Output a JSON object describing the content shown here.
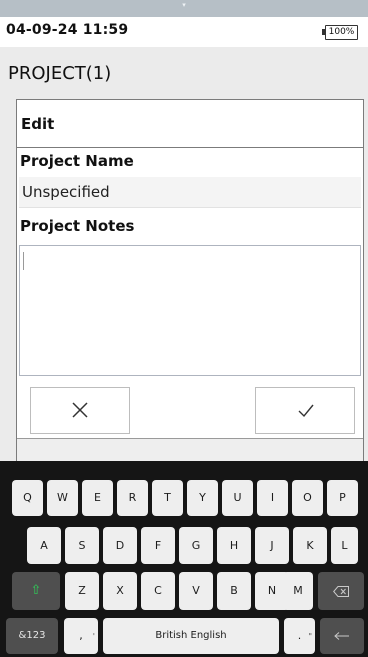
{
  "status_bar": {
    "time": "04-09-24 11:59",
    "battery": "100%"
  },
  "header": {
    "title": "PROJECT(1)"
  },
  "dialog": {
    "title": "Edit",
    "project_name_label": "Project Name",
    "project_name_value": "Unspecified",
    "project_notes_label": "Project Notes",
    "project_notes_value": "",
    "cancel_icon": "close-icon",
    "confirm_icon": "check-icon"
  },
  "keyboard": {
    "row1": [
      "Q",
      "W",
      "E",
      "R",
      "T",
      "Y",
      "U",
      "I",
      "O",
      "P"
    ],
    "row2": [
      "A",
      "S",
      "D",
      "F",
      "G",
      "H",
      "J",
      "K",
      "L"
    ],
    "row3": [
      "Z",
      "X",
      "C",
      "V",
      "B",
      "N",
      "M"
    ],
    "shift_icon": "shift-icon",
    "backspace_icon": "backspace-icon",
    "symbols_key": "&123",
    "comma_key": ",",
    "comma_hint": "'",
    "space_key": "British English",
    "period_key": ".",
    "period_hint": "\"",
    "enter_icon": "enter-icon",
    "accent_color": "#2fcf58"
  }
}
